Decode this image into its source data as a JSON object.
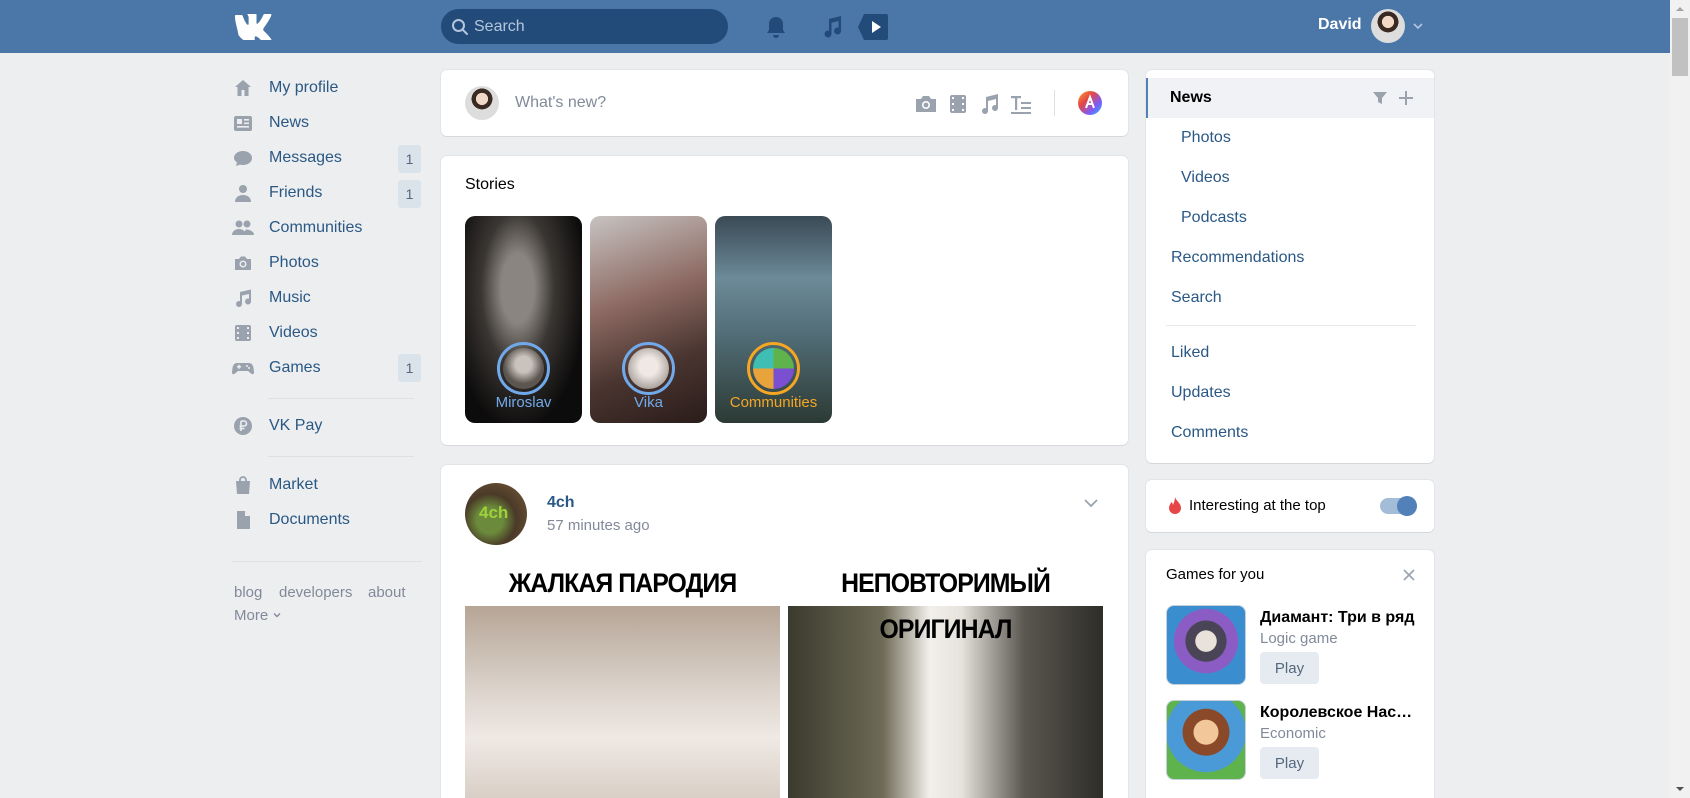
{
  "header": {
    "search_placeholder": "Search",
    "user_name": "David"
  },
  "nav": {
    "items": [
      {
        "label": "My profile",
        "icon": "home-icon"
      },
      {
        "label": "News",
        "icon": "news-icon"
      },
      {
        "label": "Messages",
        "icon": "messages-icon",
        "badge": "1"
      },
      {
        "label": "Friends",
        "icon": "friends-icon",
        "badge": "1"
      },
      {
        "label": "Communities",
        "icon": "communities-icon"
      },
      {
        "label": "Photos",
        "icon": "camera-icon"
      },
      {
        "label": "Music",
        "icon": "music-icon"
      },
      {
        "label": "Videos",
        "icon": "film-icon"
      },
      {
        "label": "Games",
        "icon": "gamepad-icon",
        "badge": "1"
      },
      {
        "label": "VK Pay",
        "icon": "vkpay-icon"
      },
      {
        "label": "Market",
        "icon": "bag-icon"
      },
      {
        "label": "Documents",
        "icon": "document-icon"
      }
    ],
    "footer": {
      "blog": "blog",
      "developers": "developers",
      "about": "about",
      "more": "More"
    }
  },
  "composer": {
    "placeholder": "What's new?"
  },
  "stories": {
    "title": "Stories",
    "items": [
      {
        "name": "Miroslav"
      },
      {
        "name": "Vika"
      },
      {
        "name": "Communities"
      }
    ]
  },
  "post": {
    "author": "4ch",
    "time": "57 minutes ago",
    "avatar_text": "4ch",
    "meme_left_caption": "ЖАЛКАЯ ПАРОДИЯ",
    "meme_right_caption": "НЕПОВТОРИМЫЙ ОРИГИНАЛ"
  },
  "right_menu": {
    "items": [
      {
        "label": "News",
        "active": true
      },
      {
        "label": "Photos"
      },
      {
        "label": "Videos"
      },
      {
        "label": "Podcasts"
      },
      {
        "label": "Recommendations"
      },
      {
        "label": "Search"
      },
      {
        "label": "Liked"
      },
      {
        "label": "Updates"
      },
      {
        "label": "Comments"
      }
    ]
  },
  "interesting": {
    "label": "Interesting at the top",
    "enabled": true
  },
  "games": {
    "title": "Games for you",
    "items": [
      {
        "title": "Диамант: Три в ряд",
        "category": "Logic game",
        "button": "Play"
      },
      {
        "title": "Королевское Наследие",
        "category": "Economic",
        "button": "Play"
      }
    ]
  },
  "colors": {
    "header": "#4a76a8",
    "link": "#2a5885",
    "accent": "#5181b8",
    "story_ring": "#71aaeb",
    "community_ring": "#f5a623"
  }
}
